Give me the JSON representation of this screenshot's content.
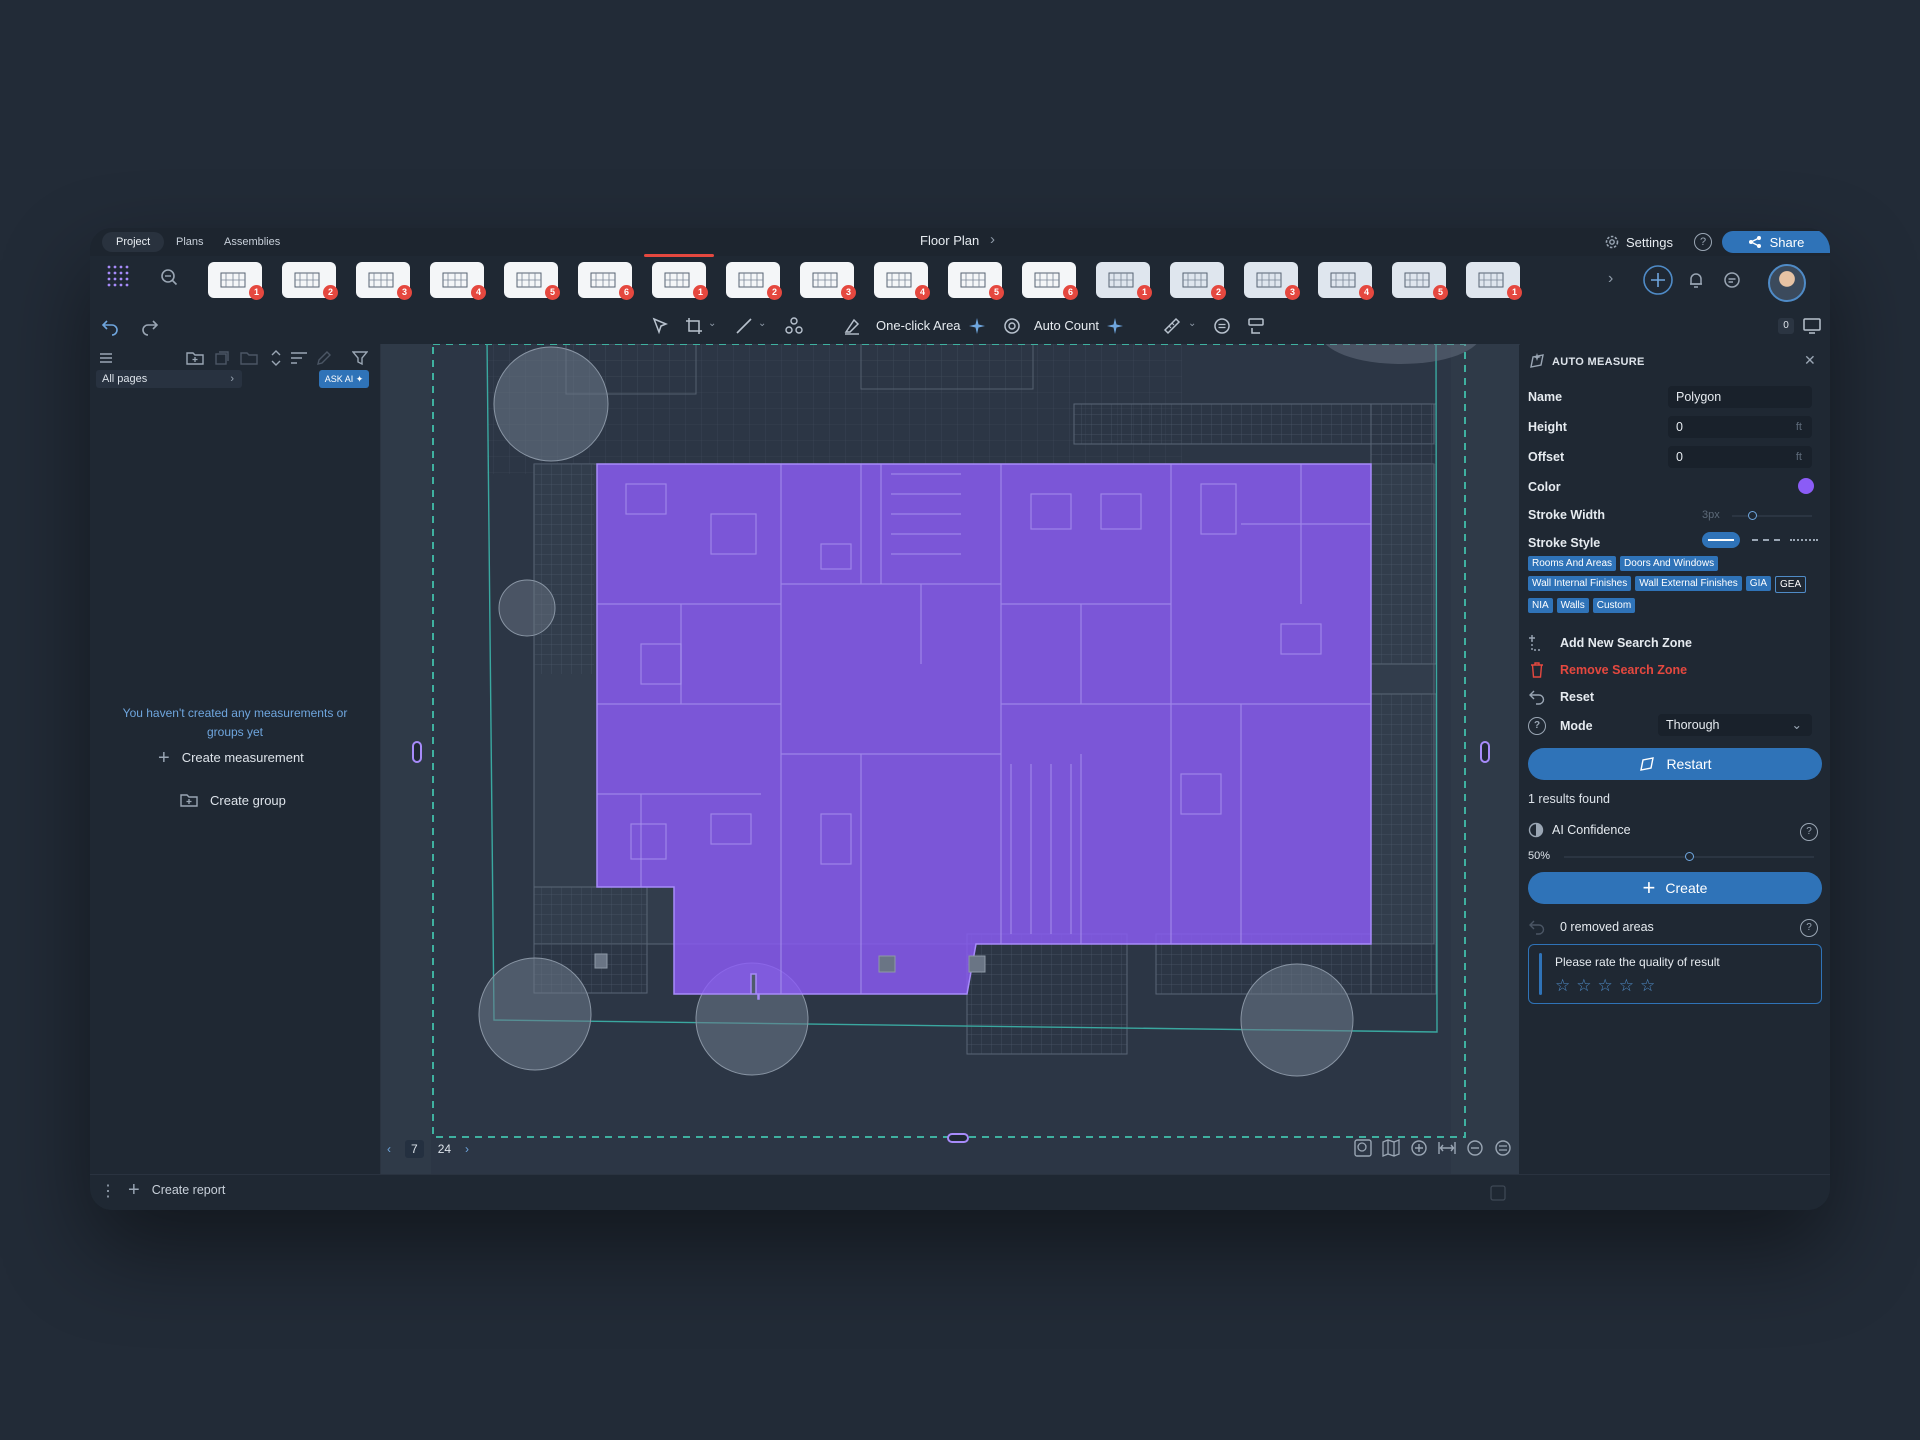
{
  "tabs": [
    "Project",
    "Plans",
    "Assemblies"
  ],
  "document": {
    "title": "Floor Plan"
  },
  "header": {
    "settings_label": "Settings",
    "share_label": "Share"
  },
  "thumbnails": [
    {
      "badge": "1"
    },
    {
      "badge": "2"
    },
    {
      "badge": "3"
    },
    {
      "badge": "4"
    },
    {
      "badge": "5"
    },
    {
      "badge": "6"
    },
    {
      "badge": "1"
    },
    {
      "badge": "2"
    },
    {
      "badge": "3"
    },
    {
      "badge": "4"
    },
    {
      "badge": "5"
    },
    {
      "badge": "6"
    },
    {
      "badge": "1"
    },
    {
      "badge": "2"
    },
    {
      "badge": "3"
    },
    {
      "badge": "4"
    },
    {
      "badge": "5"
    },
    {
      "badge": "1"
    }
  ],
  "toolbar": {
    "one_click_area": "One-click Area",
    "auto_count": "Auto Count",
    "counter": "0"
  },
  "sidebar": {
    "filter_label": "All pages",
    "ask_ai_label": "ASK AI",
    "empty_message": "You haven't created any measurements or groups yet",
    "create_measurement": "Create measurement",
    "create_group": "Create group"
  },
  "pager": {
    "current_page": "7",
    "total_pages": "24"
  },
  "auto_measure": {
    "title": "AUTO MEASURE",
    "name_label": "Name",
    "name_value": "Polygon",
    "height_label": "Height",
    "height_value": "0",
    "height_unit": "ft",
    "offset_label": "Offset",
    "offset_value": "0",
    "offset_unit": "ft",
    "color_label": "Color",
    "color_value": "#8b5cf6",
    "stroke_width_label": "Stroke Width",
    "stroke_width_value": "3px",
    "stroke_style_label": "Stroke Style",
    "tags": [
      "Rooms And Areas",
      "Doors And Windows",
      "Wall Internal Finishes",
      "Wall External Finishes",
      "GIA",
      "GEA",
      "NIA",
      "Walls",
      "Custom"
    ],
    "add_zone": "Add New Search Zone",
    "remove_zone": "Remove Search Zone",
    "reset": "Reset",
    "mode_label": "Mode",
    "mode_value": "Thorough",
    "restart": "Restart",
    "results": "1 results found",
    "ai_confidence_label": "AI Confidence",
    "ai_confidence_value": "50%",
    "ai_confidence_fraction": 0.5,
    "create": "Create",
    "removed_areas": "0 removed areas",
    "rate_prompt": "Please rate the quality of result",
    "rating": 0
  },
  "footer": {
    "create_report": "Create report"
  }
}
